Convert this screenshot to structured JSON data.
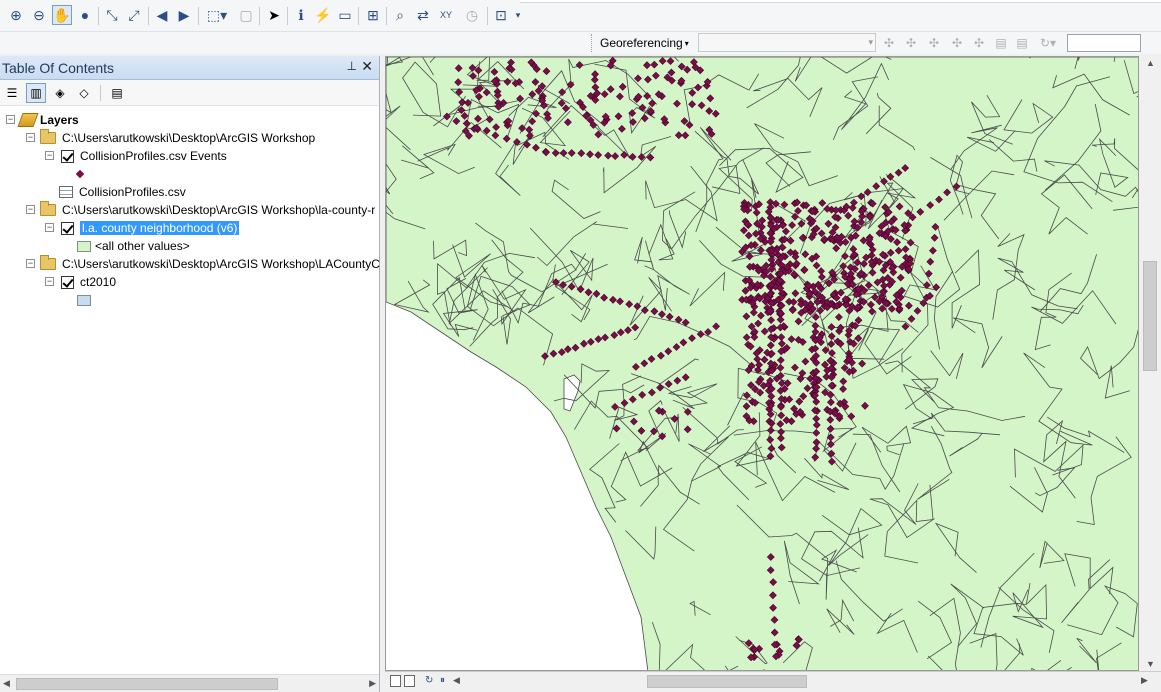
{
  "toolbar": {
    "tools": [
      "zoom-in-icon",
      "zoom-out-icon",
      "pan-icon",
      "full-extent-icon",
      "fixed-zoom-in-icon",
      "fixed-zoom-out-icon",
      "back-extent-icon",
      "forward-extent-icon",
      "select-features-icon",
      "clear-selection-icon",
      "select-elements-icon",
      "identify-icon",
      "hyperlink-icon",
      "html-popup-icon",
      "measure-icon",
      "find-icon",
      "find-route-icon",
      "go-to-xy-icon",
      "time-slider-icon",
      "create-viewer-icon"
    ]
  },
  "georeferencing": {
    "menu_label": "Georeferencing",
    "layer_value": "",
    "scale_value": ""
  },
  "toc": {
    "title": "Table Of Contents",
    "root_label": "Layers",
    "items": [
      {
        "label": "C:\\Users\\arutkowski\\Desktop\\ArcGIS Workshop"
      },
      {
        "label": "CollisionProfiles.csv Events"
      },
      {
        "label": "CollisionProfiles.csv"
      },
      {
        "label": "C:\\Users\\arutkowski\\Desktop\\ArcGIS Workshop\\la-county-r"
      },
      {
        "label": "l.a. county neighborhood (v6)"
      },
      {
        "label": "<all other values>"
      },
      {
        "label": "C:\\Users\\arutkowski\\Desktop\\ArcGIS Workshop\\LACountyC"
      },
      {
        "label": "ct2010"
      }
    ]
  },
  "colors": {
    "land": "#d3f5c8",
    "points": "#7a0d49",
    "boundary": "#4a4a4a",
    "selection": "#3399ff"
  }
}
